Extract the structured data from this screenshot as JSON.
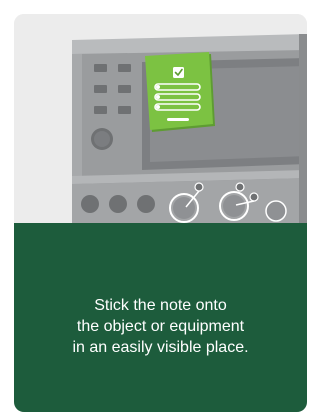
{
  "instruction_card": {
    "caption_lines": [
      "Stick the note onto",
      "the object or equipment",
      "in an easily visible place."
    ],
    "colors": {
      "card_background": "#ececec",
      "panel_green": "#1d5c3c",
      "note_green": "#7cc242",
      "machine_gray": "#9a9c9e",
      "machine_dark": "#6f7173",
      "screen": "#8b8d90"
    },
    "icons": [
      "checkmark-icon"
    ]
  }
}
